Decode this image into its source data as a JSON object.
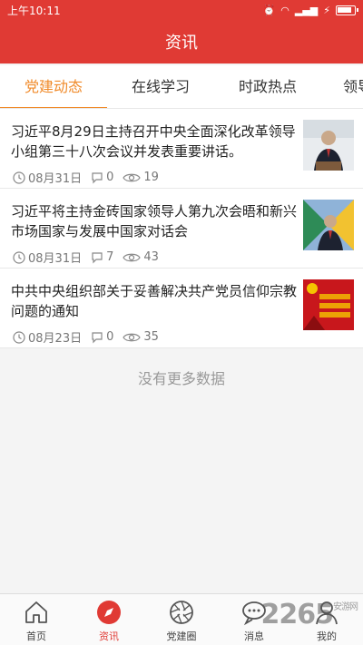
{
  "status_bar": {
    "time": "上午10:11"
  },
  "header": {
    "title": "资讯"
  },
  "tabs": [
    {
      "label": "党建动态",
      "active": true
    },
    {
      "label": "在线学习",
      "active": false
    },
    {
      "label": "时政热点",
      "active": false
    },
    {
      "label": "领导",
      "active": false
    }
  ],
  "news": [
    {
      "title": "习近平8月29日主持召开中央全面深化改革领导小组第三十八次会议并发表重要讲话。",
      "date": "08月31日",
      "comments": "0",
      "views": "19",
      "thumb_icon": "leader-photo"
    },
    {
      "title": "习近平将主持金砖国家领导人第九次会晤和新兴市场国家与发展中国家对话会",
      "date": "08月31日",
      "comments": "7",
      "views": "43",
      "thumb_icon": "summit-photo"
    },
    {
      "title": "中共中央组织部关于妥善解决共产党员信仰宗教问题的通知",
      "date": "08月23日",
      "comments": "0",
      "views": "35",
      "thumb_icon": "party-banner-photo"
    }
  ],
  "no_more_text": "没有更多数据",
  "bottom_nav": [
    {
      "label": "首页",
      "icon": "home-icon"
    },
    {
      "label": "资讯",
      "icon": "compass-icon",
      "active": true
    },
    {
      "label": "党建圈",
      "icon": "aperture-icon"
    },
    {
      "label": "消息",
      "icon": "chat-icon"
    },
    {
      "label": "我的",
      "icon": "person-icon"
    }
  ],
  "watermark": {
    "text": "2265",
    "small": "安游网"
  },
  "colors": {
    "primary": "#e03a34",
    "tab_active": "#f08b2b",
    "meta_gray": "#777"
  }
}
